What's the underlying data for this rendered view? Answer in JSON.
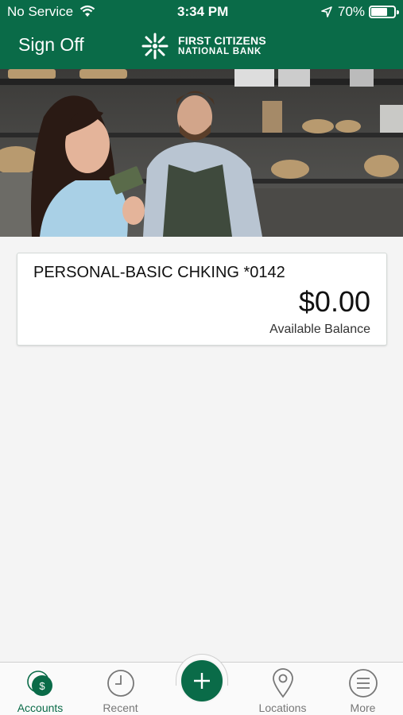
{
  "status_bar": {
    "carrier": "No Service",
    "time": "3:34 PM",
    "battery": "70%",
    "battery_level": 0.7
  },
  "header": {
    "sign_off_label": "Sign Off",
    "bank_name_line1": "FIRST CITIZENS",
    "bank_name_line2": "NATIONAL BANK"
  },
  "accounts": [
    {
      "name": "PERSONAL-BASIC CHKING *0142",
      "balance": "$0.00",
      "balance_label": "Available Balance"
    }
  ],
  "tab_bar": {
    "tabs": [
      {
        "label": "Accounts",
        "icon": "dollar-circle-icon",
        "active": true
      },
      {
        "label": "Recent",
        "icon": "clock-icon",
        "active": false
      },
      {
        "label": "",
        "icon": "plus-icon",
        "active": false
      },
      {
        "label": "Locations",
        "icon": "location-pin-icon",
        "active": false
      },
      {
        "label": "More",
        "icon": "menu-icon",
        "active": false
      }
    ]
  },
  "colors": {
    "brand_green": "#0a6b48",
    "background": "#f4f4f4",
    "inactive_tab": "#777777"
  }
}
